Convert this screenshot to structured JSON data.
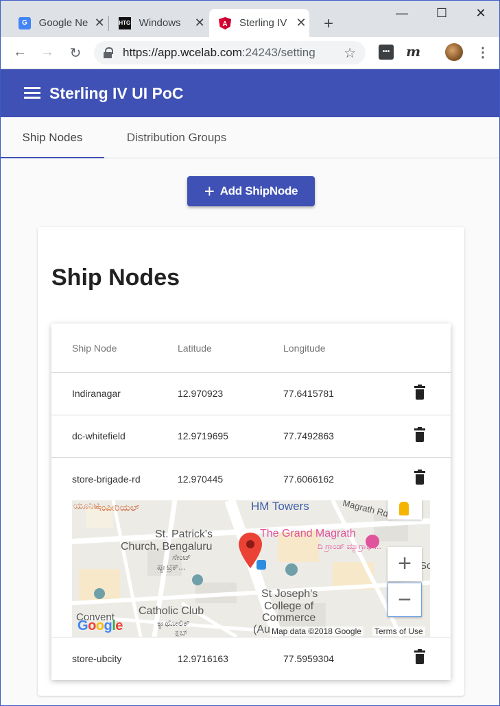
{
  "browser": {
    "tabs": [
      {
        "title": "Google Ne",
        "icon": "google-news-icon"
      },
      {
        "title": "Windows",
        "icon": "htg-icon",
        "icon_text": "HTG"
      },
      {
        "title": "Sterling IV",
        "icon": "angular-icon",
        "active": true
      }
    ],
    "url_host": "https://app.wcelab.com",
    "url_rest": ":24243/setting",
    "ext_m": "m"
  },
  "app": {
    "title": "Sterling IV UI PoC",
    "primary_color": "#3f51b5"
  },
  "nav_tabs": [
    {
      "label": "Ship Nodes",
      "active": true
    },
    {
      "label": "Distribution Groups",
      "active": false
    }
  ],
  "add_button": {
    "label": "Add ShipNode",
    "icon": "plus-icon"
  },
  "card": {
    "title": "Ship Nodes"
  },
  "table": {
    "headers": [
      "Ship Node",
      "Latitude",
      "Longitude"
    ],
    "rows": [
      {
        "node": "Indiranagar",
        "lat": "12.970923",
        "lon": "77.6415781"
      },
      {
        "node": "dc-whitefield",
        "lat": "12.9719695",
        "lon": "77.7492863"
      },
      {
        "node": "store-brigade-rd",
        "lat": "12.970445",
        "lon": "77.6066162"
      },
      {
        "node": "store-ubcity",
        "lat": "12.9716163",
        "lon": "77.5959304"
      }
    ]
  },
  "map": {
    "labels": {
      "hm_towers": "HM Towers",
      "magrath_rd": "Magrath Rd",
      "grand_magrath": "The Grand Magrath",
      "grand_magrath_kn": "ದಿ ಗ್ರಾಂಡ್ ಮ್ಯಾಗ್ರಾಥ್...",
      "st_patricks": "St. Patrick's",
      "church": "Church, Bengaluru",
      "st_patricks_kn": "ಸೇಂಟ್",
      "st_patricks_kn2": "ಪ್ಯಾಟ್ರಿಕ್...",
      "imperial_kn": "ಇಂಪೀರಿಯಲ್",
      "top_kn": "ಯೂನಿಟಿ",
      "st_josephs": "St Joseph's",
      "college": "College of",
      "commerce": "Commerce",
      "au": "(Au",
      "catholic_club": "Catholic Club",
      "catholic_club_kn": "ಕ್ಯಾಥೋಲಿಕ್",
      "catholic_club_kn2": "ಕ್ಲಬ್",
      "convent": "Convent",
      "sc": "Sc",
      "google": "Google",
      "map_data": "Map data ©2018 Google",
      "terms": "Terms of Use"
    },
    "zoom_in": "+",
    "zoom_out": "−"
  }
}
